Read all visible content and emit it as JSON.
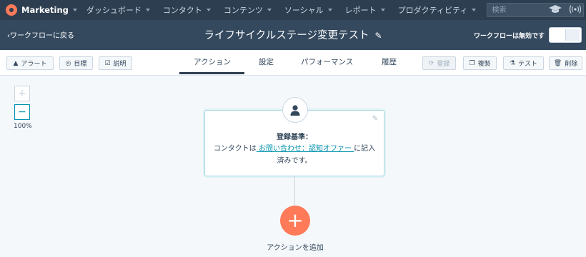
{
  "nav": {
    "brand": "Marketing",
    "items": [
      "ダッシュボード",
      "コンタクト",
      "コンテンツ",
      "ソーシャル",
      "レポート",
      "プロダクティビティ"
    ],
    "search_placeholder": "検索"
  },
  "header": {
    "back_label": "ワークフローに戻る",
    "title": "ライフサイクルステージ変更テスト",
    "toggle_label": "ワークフローは無効です"
  },
  "toolbar": {
    "alert": "アラート",
    "goal": "目標",
    "description": "説明",
    "tabs": [
      "アクション",
      "設定",
      "パフォーマンス",
      "履歴"
    ],
    "register": "登録",
    "clone": "複製",
    "test": "テスト",
    "delete": "削除"
  },
  "canvas": {
    "zoom_level": "100%",
    "trigger": {
      "title": "登録基準：",
      "text_before": "コンタクトは",
      "link": " お問い合わせ：認知オファー ",
      "text_after": "に記入済みです。"
    },
    "add_action_label": "アクションを追加"
  },
  "colors": {
    "nav_bg": "#2d3e50",
    "header_bg": "#34495e",
    "accent": "#ff7a59",
    "link": "#0091ae"
  }
}
